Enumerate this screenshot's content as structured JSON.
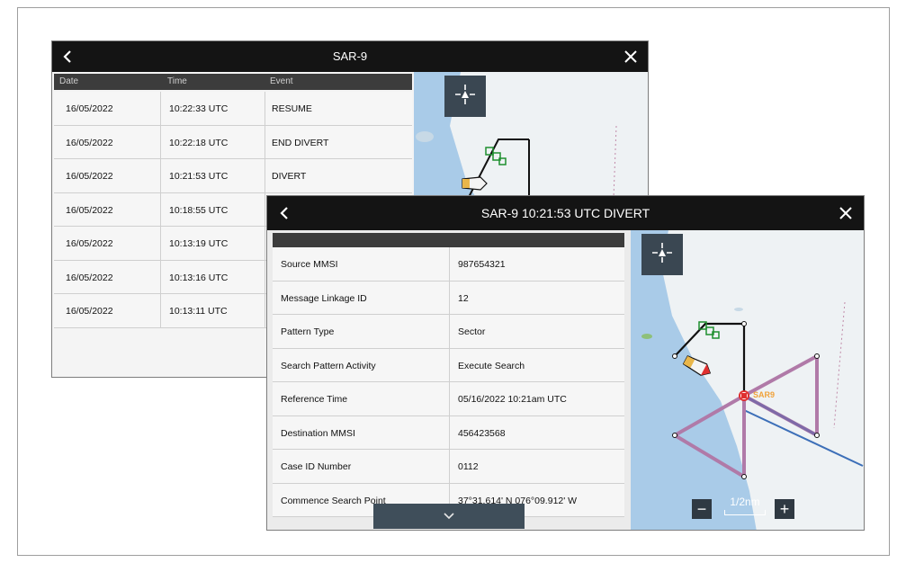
{
  "back_window": {
    "title": "SAR-9",
    "columns": [
      "Date",
      "Time",
      "Event"
    ],
    "rows": [
      {
        "date": "16/05/2022",
        "time": "10:22:33 UTC",
        "event": "RESUME"
      },
      {
        "date": "16/05/2022",
        "time": "10:22:18 UTC",
        "event": "END DIVERT"
      },
      {
        "date": "16/05/2022",
        "time": "10:21:53 UTC",
        "event": "DIVERT"
      },
      {
        "date": "16/05/2022",
        "time": "10:18:55 UTC",
        "event": ""
      },
      {
        "date": "16/05/2022",
        "time": "10:13:19 UTC",
        "event": ""
      },
      {
        "date": "16/05/2022",
        "time": "10:13:16 UTC",
        "event": ""
      },
      {
        "date": "16/05/2022",
        "time": "10:13:11 UTC",
        "event": ""
      }
    ]
  },
  "front_window": {
    "title": "SAR-9 10:21:53 UTC DIVERT",
    "rows": [
      {
        "label": "Source MMSI",
        "value": "987654321"
      },
      {
        "label": "Message Linkage ID",
        "value": "12"
      },
      {
        "label": "Pattern Type",
        "value": "Sector"
      },
      {
        "label": "Search Pattern Activity",
        "value": "Execute Search"
      },
      {
        "label": "Reference Time",
        "value": "05/16/2022 10:21am UTC"
      },
      {
        "label": "Destination MMSI",
        "value": "456423568"
      },
      {
        "label": "Case ID Number",
        "value": "0112"
      },
      {
        "label": "Commence Search Point",
        "value": "37°31.614' N 076°09.912' W"
      }
    ],
    "map": {
      "scale_label": "1/2nm",
      "zoom_out_label": "−",
      "zoom_in_label": "+",
      "target_label": "SAR9"
    }
  },
  "icons": {
    "back": "chevron-left-icon",
    "close": "close-icon",
    "scroll_down": "chevron-down-icon",
    "center": "crosshair-icon",
    "vessel": "vessel-icon"
  },
  "colors": {
    "titlebar": "#141414",
    "sea": "#a9cbe8",
    "pattern": "#b07aa8",
    "track": "#111111",
    "target": "#e03030",
    "scroll_button": "#3f4e5a"
  }
}
